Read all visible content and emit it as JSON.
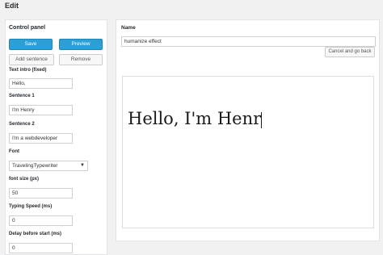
{
  "page": {
    "title": "Edit"
  },
  "control_panel": {
    "title": "Control panel",
    "save_label": "Save",
    "preview_label": "Preview",
    "add_sentence_label": "Add sentence",
    "remove_label": "Remove",
    "fields": {
      "text_intro": {
        "label": "Text intro (fixed)",
        "value": "Hello,"
      },
      "sentence1": {
        "label": "Sentence 1",
        "value": "I'm Henry"
      },
      "sentence2": {
        "label": "Sentence 2",
        "value": "I'm a webdeveloper"
      },
      "font": {
        "label": "Font",
        "value": "TravelingTypewriter"
      },
      "font_size": {
        "label": "font size (px)",
        "value": "50"
      },
      "typing_speed": {
        "label": "Typing Speed (ms)",
        "value": "0"
      },
      "delay": {
        "label": "Delay before start (ms)",
        "value": "0"
      }
    }
  },
  "editor": {
    "name_label": "Name",
    "name_value": "humanize effect",
    "cancel_label": "Cancel and go back",
    "preview_text": "Hello, I'm Henr"
  },
  "colors": {
    "primary": "#2b9fd6",
    "background": "#f1f1f1"
  }
}
